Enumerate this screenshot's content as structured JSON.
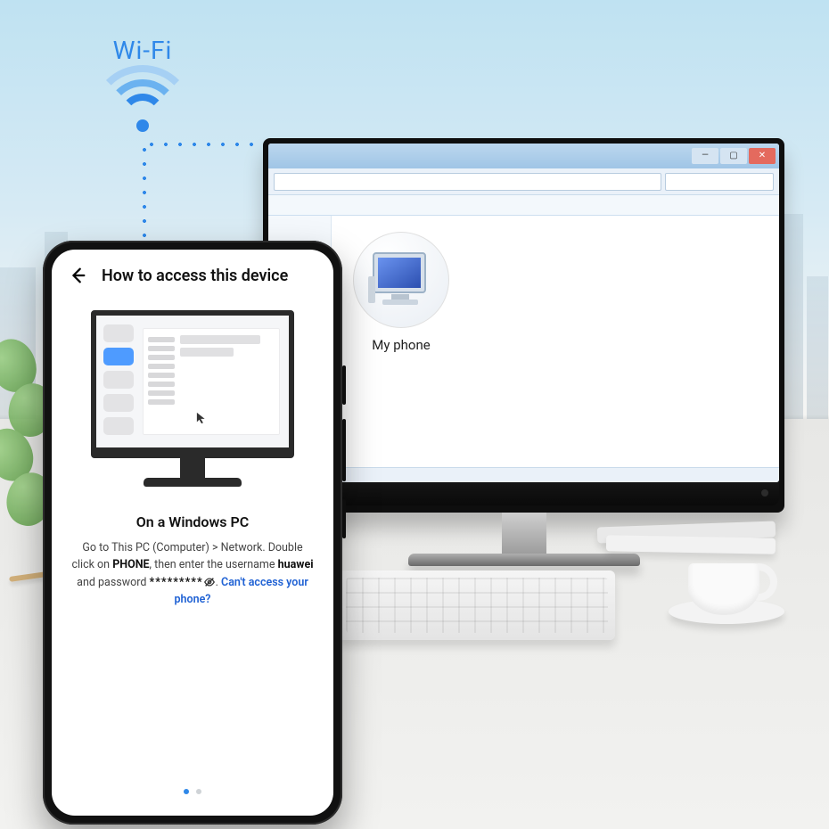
{
  "wifi_label": "Wi-Fi",
  "monitor": {
    "explorer": {
      "device_label": "My phone"
    }
  },
  "phone": {
    "title": "How to access this device",
    "section_heading": "On a Windows PC",
    "instr_part1": "Go to This PC (Computer) > Network. Double click on ",
    "instr_bold1": "PHONE",
    "instr_part2": ", then enter the username ",
    "instr_bold2": "huawei",
    "instr_part3": " and password ",
    "password_mask": "*********",
    "instr_part4": ". ",
    "help_link": "Can't access your phone?",
    "pager_index": 0,
    "pager_total": 2
  }
}
